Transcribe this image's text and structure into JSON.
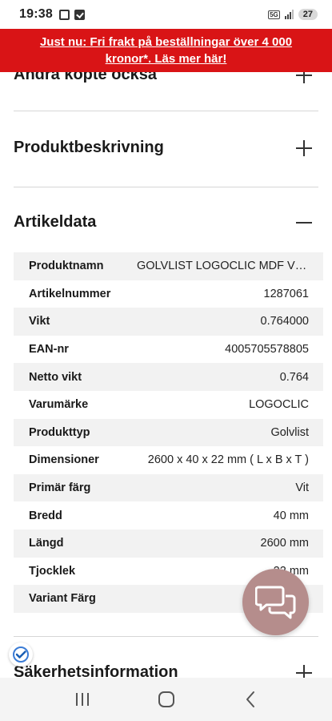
{
  "status_bar": {
    "time": "19:38",
    "network": "5G",
    "battery": "27"
  },
  "promo": {
    "text": "Just nu: Fri frakt på beställningar över 4 000 kronor*. Läs mer här!",
    "bg_color": "#d91416"
  },
  "accordions": {
    "also_bought": "Andra köpte också",
    "description": "Produktbeskrivning",
    "article_data": "Artikeldata",
    "safety": "Säkerhetsinformation"
  },
  "article_data": [
    {
      "key": "Produktnamn",
      "value": "GOLVLIST LOGOCLIC MDF VIT..."
    },
    {
      "key": "Artikelnummer",
      "value": "1287061"
    },
    {
      "key": "Vikt",
      "value": "0.764000"
    },
    {
      "key": "EAN-nr",
      "value": "4005705578805"
    },
    {
      "key": "Netto vikt",
      "value": "0.764"
    },
    {
      "key": "Varumärke",
      "value": "LOGOCLIC"
    },
    {
      "key": "Produkttyp",
      "value": "Golvlist"
    },
    {
      "key": "Dimensioner",
      "value": "2600 x 40 x 22 mm ( L x B x T )"
    },
    {
      "key": "Primär färg",
      "value": "Vit"
    },
    {
      "key": "Bredd",
      "value": "40 mm"
    },
    {
      "key": "Längd",
      "value": "2600 mm"
    },
    {
      "key": "Tjocklek",
      "value": "22 mm"
    },
    {
      "key": "Variant Färg",
      "value": ""
    }
  ],
  "icons": {
    "chat": "chat-bubbles-icon",
    "trust": "checkmark-badge-icon",
    "expand": "plus-icon",
    "collapse": "minus-icon"
  },
  "colors": {
    "chat_fab": "#b58d8c",
    "row_alt": "#f2f2f2"
  }
}
